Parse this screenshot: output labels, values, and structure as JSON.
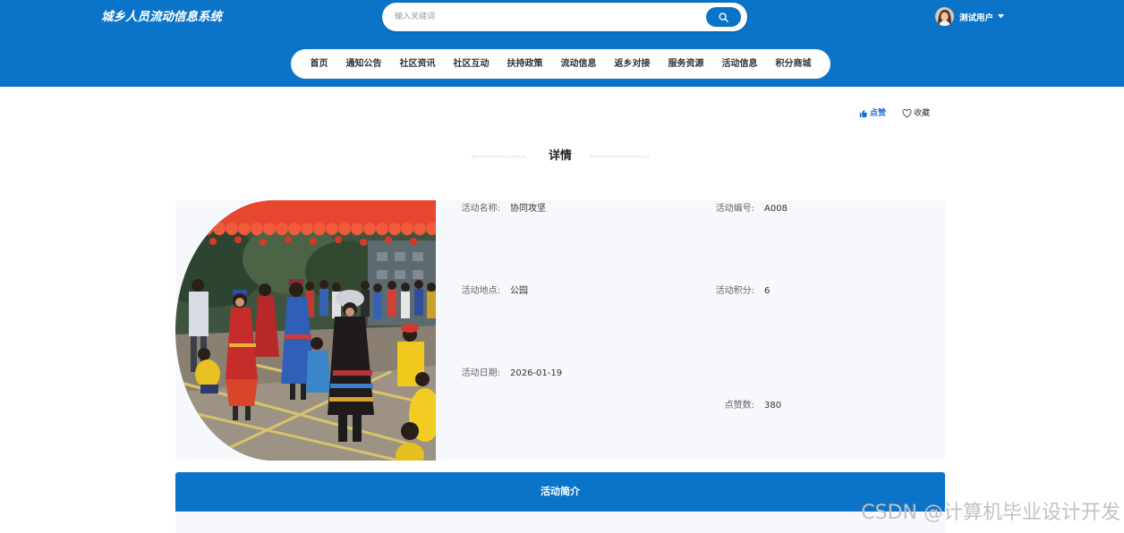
{
  "header": {
    "site_title": "城乡人员流动信息系统",
    "search": {
      "placeholder": "输入关键词",
      "button_icon": "search-icon"
    },
    "user": {
      "name": "测试用户",
      "menu_icon": "caret-down-icon"
    }
  },
  "nav": {
    "items": [
      "首页",
      "通知公告",
      "社区资讯",
      "社区互动",
      "扶持政策",
      "流动信息",
      "返乡对接",
      "服务资源",
      "活动信息",
      "积分商城"
    ]
  },
  "actions": {
    "like": {
      "label": "点赞",
      "icon": "thumbs-up-icon"
    },
    "favorite": {
      "label": "收藏",
      "icon": "heart-icon"
    }
  },
  "section_title": "详情",
  "detail": {
    "name": {
      "label": "活动名称:",
      "value": "协同攻坚"
    },
    "code": {
      "label": "活动编号:",
      "value": "A008"
    },
    "location": {
      "label": "活动地点:",
      "value": "公园"
    },
    "points": {
      "label": "活动积分:",
      "value": "6"
    },
    "date": {
      "label": "活动日期:",
      "value": "2026-01-19"
    },
    "likes": {
      "label": "点赞数:",
      "value": "380"
    }
  },
  "intro": {
    "title": "活动简介"
  },
  "watermark": "CSDN @计算机毕业设计开发",
  "colors": {
    "primary": "#0b74c9",
    "like": "#1a6ccf",
    "panel": "#f6f8fc",
    "text": "#333333"
  }
}
